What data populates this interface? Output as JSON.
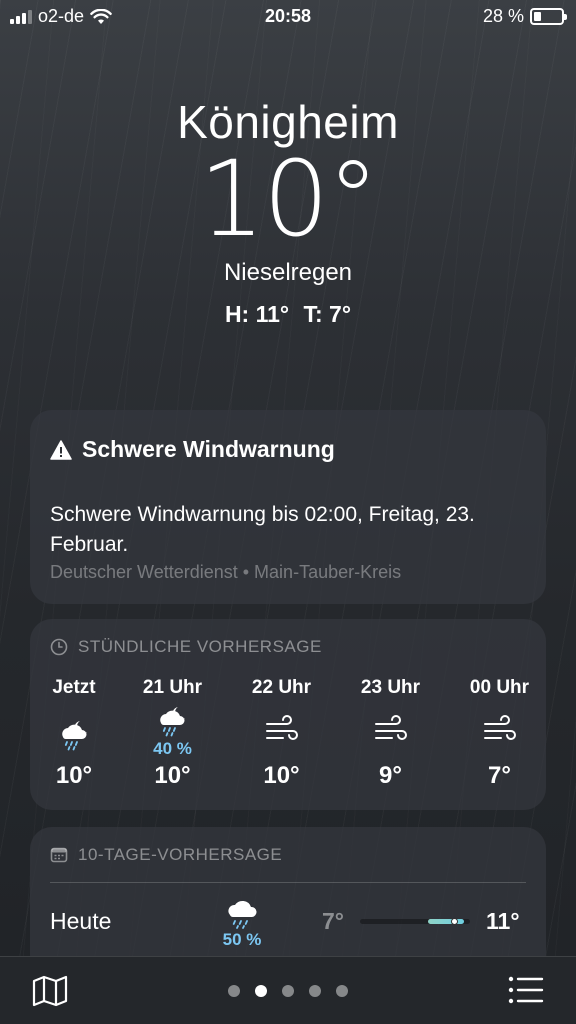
{
  "status_bar": {
    "carrier": "o2-de",
    "time": "20:58",
    "battery": "28 %",
    "battery_level": 0.28
  },
  "header": {
    "city": "Königheim",
    "temperature": "10°",
    "condition": "Nieselregen",
    "high": "H: 11°",
    "low": "T: 7°"
  },
  "warning": {
    "icon": "warning-triangle-icon",
    "title": "Schwere Windwarnung",
    "text": "Schwere Windwarnung bis 02:00, Freitag, 23. Februar.",
    "source": "Deutscher Wetterdienst • Main-Tauber-Kreis"
  },
  "hourly": {
    "icon": "clock-icon",
    "heading": "STÜNDLICHE VORHERSAGE",
    "hours": [
      {
        "label": "Jetzt",
        "icon": "night-cloud-drizzle-icon",
        "precip": "",
        "temp": "10°"
      },
      {
        "label": "21 Uhr",
        "icon": "night-cloud-drizzle-icon",
        "precip": "40 %",
        "temp": "10°"
      },
      {
        "label": "22 Uhr",
        "icon": "wind-icon",
        "precip": "",
        "temp": "10°"
      },
      {
        "label": "23 Uhr",
        "icon": "wind-icon",
        "precip": "",
        "temp": "9°"
      },
      {
        "label": "00 Uhr",
        "icon": "wind-icon",
        "precip": "",
        "temp": "7°"
      }
    ]
  },
  "ten_day": {
    "icon": "calendar-icon",
    "heading": "10-TAGE-VORHERSAGE",
    "days": [
      {
        "day": "Heute",
        "icon": "cloud-rain-icon",
        "precip": "50 %",
        "low": "7°",
        "high": "11°",
        "range_start": 0.62,
        "range_end": 0.95,
        "current": 0.86
      }
    ]
  },
  "bottom_bar": {
    "map_icon": "map-icon",
    "list_icon": "list-icon",
    "pages": 5,
    "active_page": 1
  },
  "colors": {
    "precip": "#7cc7f2",
    "range_bar": "#8fd3c7"
  }
}
